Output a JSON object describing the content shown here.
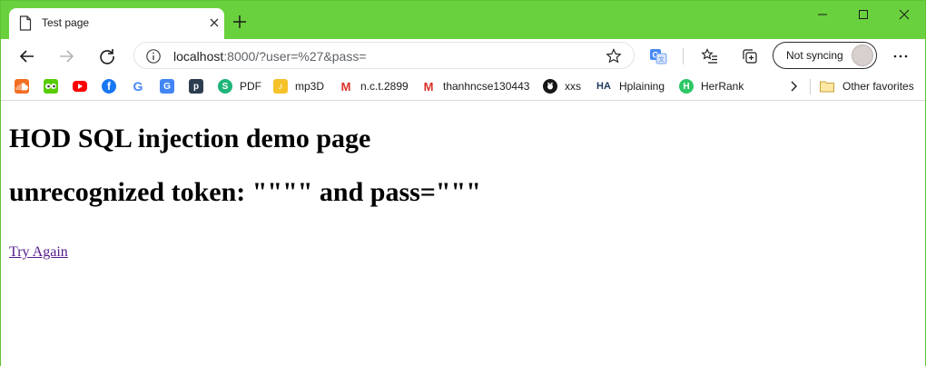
{
  "browser": {
    "tab": {
      "title": "Test page"
    },
    "address": {
      "host": "localhost",
      "rest": ":8000/?user=%27&pass="
    },
    "profile": {
      "sync_label": "Not syncing"
    },
    "accent": "#6ad13e"
  },
  "bookmarks": {
    "items": [
      {
        "label": "",
        "icon": "soundcloud-icon",
        "color": "#f26f23"
      },
      {
        "label": "",
        "icon": "duolingo-icon",
        "color": "#58cc02"
      },
      {
        "label": "",
        "icon": "youtube-icon",
        "color": "#ff0000"
      },
      {
        "label": "",
        "icon": "facebook-icon",
        "color": "#1877f2"
      },
      {
        "label": "",
        "icon": "google-icon",
        "color": "#4285f4"
      },
      {
        "label": "",
        "icon": "google-translate-icon",
        "color": "#4285f4"
      },
      {
        "label": "",
        "icon": "p-icon",
        "color": "#2b3e50"
      },
      {
        "label": "PDF",
        "icon": "s-pdf-icon",
        "color": "#1fb57a"
      },
      {
        "label": "mp3D",
        "icon": "mp3d-icon",
        "color": "#f5c22b"
      },
      {
        "label": "n.c.t.2899",
        "icon": "gmail-icon",
        "color": "#d93025"
      },
      {
        "label": "thanhncse130443",
        "icon": "gmail-icon",
        "color": "#d93025"
      },
      {
        "label": "xxs",
        "icon": "github-icon",
        "color": "#181717"
      },
      {
        "label": "Hplaining",
        "icon": "ha-icon",
        "color": "#1b3a5c"
      },
      {
        "label": "HerRank",
        "icon": "hackerrank-icon",
        "color": "#2ec866"
      }
    ],
    "other_favorites": "Other favorites"
  },
  "page": {
    "heading": "HOD SQL injection demo page",
    "error": "unrecognized token: \"\"\"\" and pass=\"\"\"",
    "link": "Try Again"
  }
}
